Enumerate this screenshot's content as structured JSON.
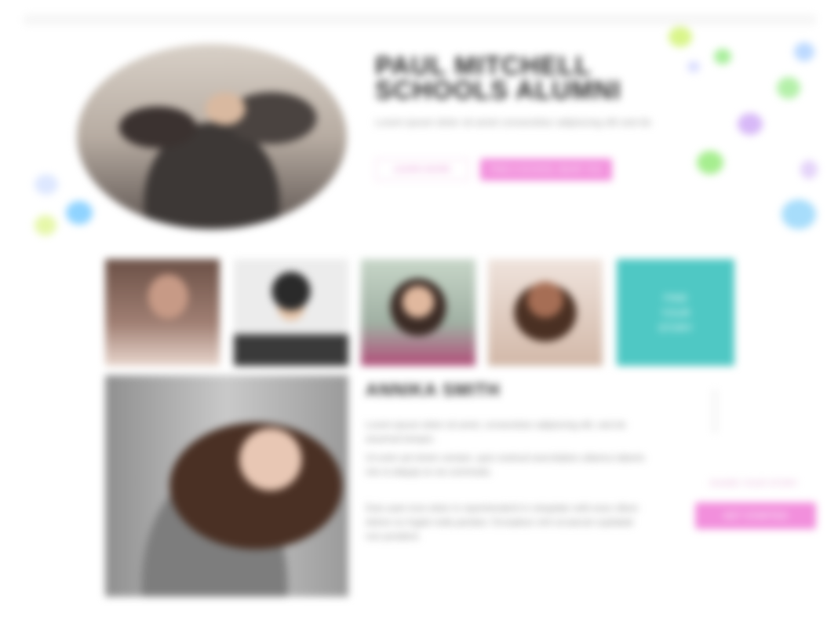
{
  "hero": {
    "title": "PAUL MITCHELL SCHOOLS ALUMNI",
    "subtitle": "Lorem ipsum dolor sit amet consectetur adipiscing elit sed do",
    "secondary_button": "LEARN MORE",
    "primary_button": "FIND A SCHOOL NEAR YOU"
  },
  "tiles": {
    "cta_lines": [
      "FIND",
      "YOUR",
      "STORY"
    ]
  },
  "profile": {
    "name": "ANNIKA SMITH",
    "paragraphs": [
      "Lorem ipsum dolor sit amet, consectetur adipiscing elit, sed do eiusmod tempor.",
      "Ut enim ad minim veniam, quis nostrud exercitation ullamco laboris nisi ut aliquip ex ea commodo.",
      "Duis aute irure dolor in reprehenderit in voluptate velit esse cillum dolore eu fugiat nulla pariatur. Excepteur sint occaecat cupidatat non proident."
    ]
  },
  "side": {
    "label": "SHARE YOUR STORY",
    "button": "GET STARTED"
  },
  "colors": {
    "accent_pink": "#f28fdc",
    "accent_teal": "#4fc8c4"
  }
}
